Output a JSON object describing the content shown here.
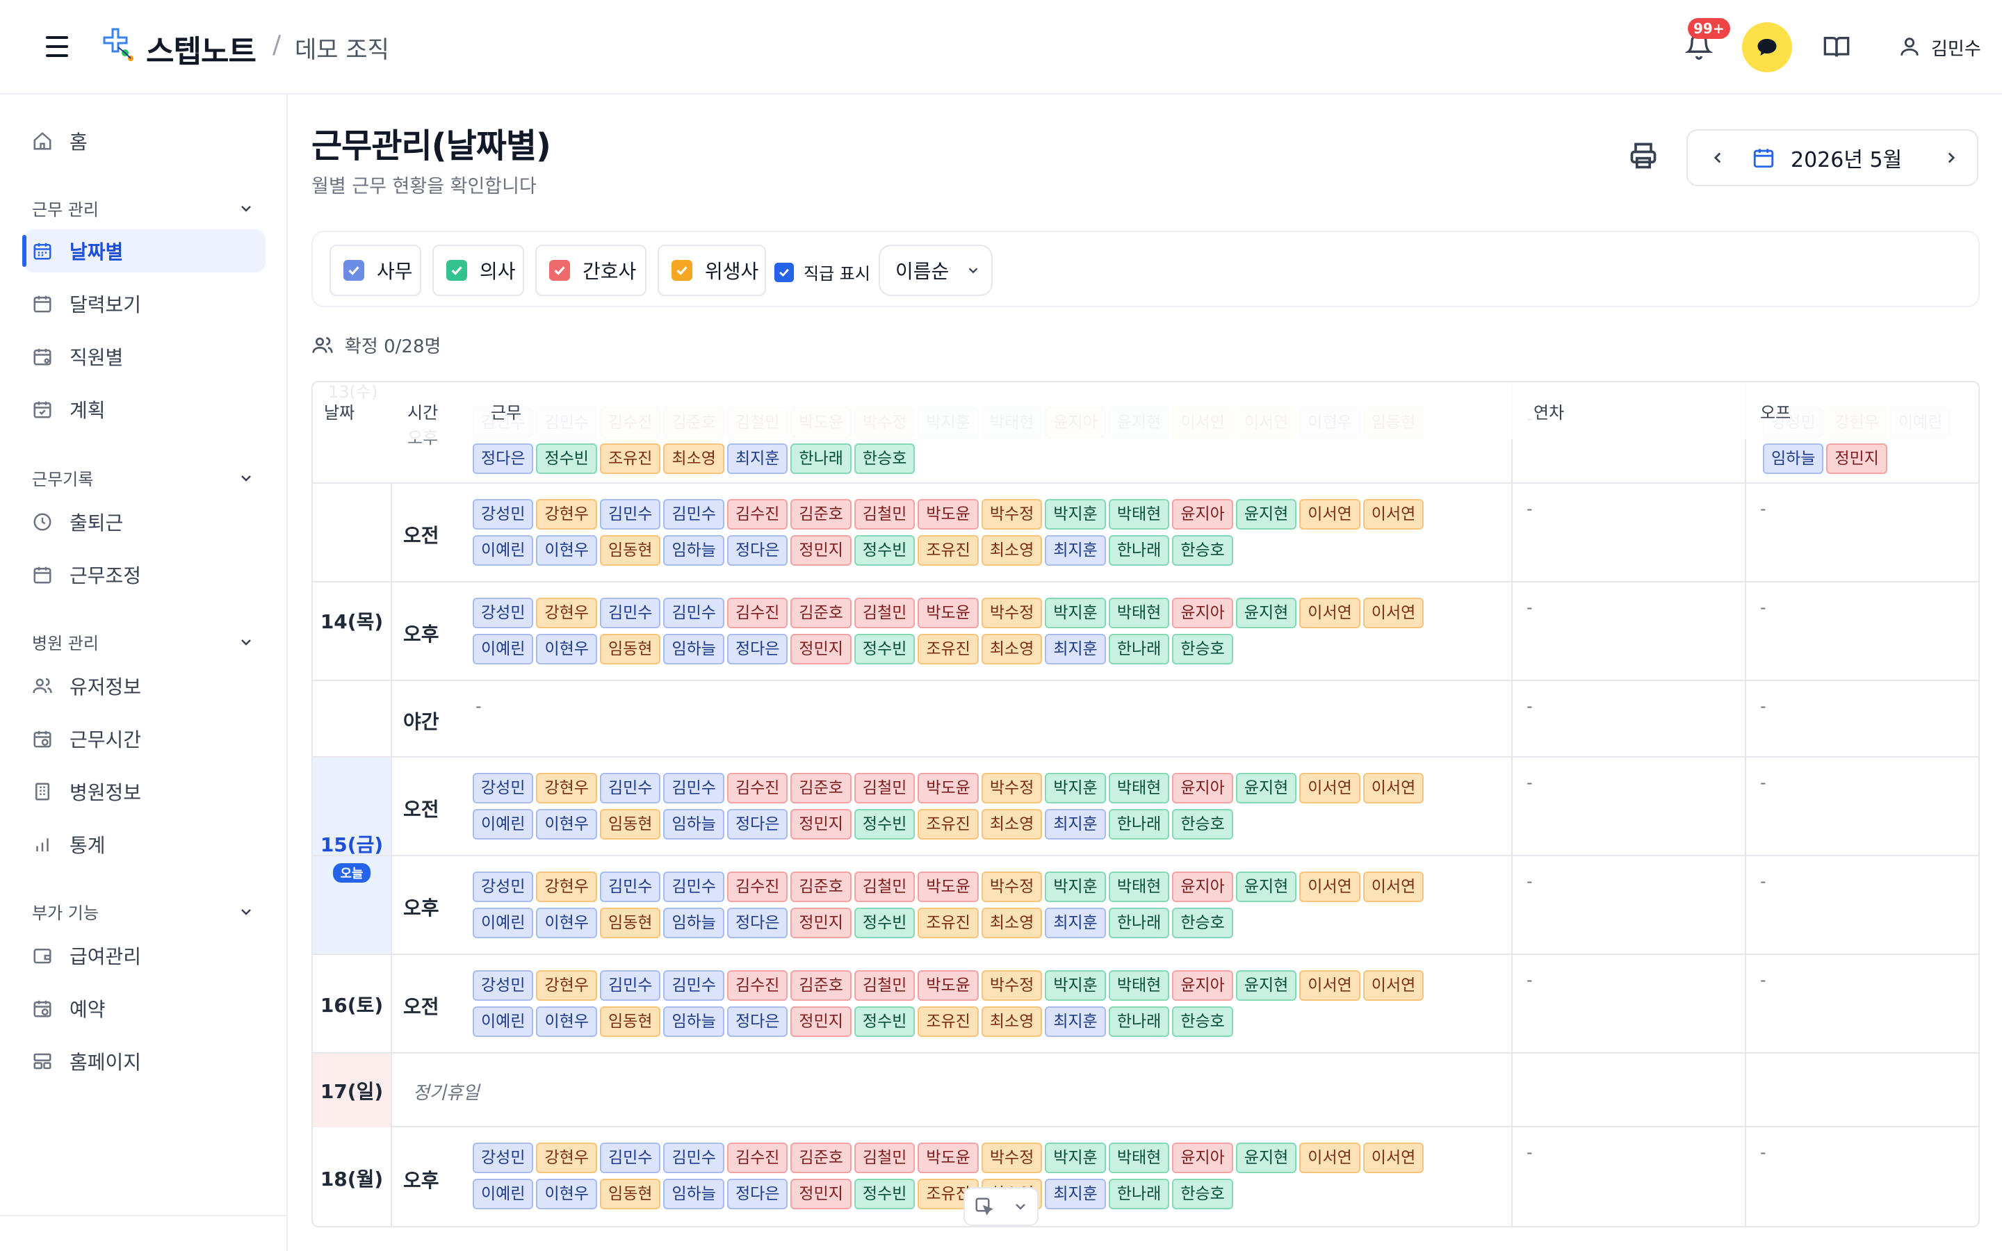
{
  "header": {
    "brand": "스텝노트",
    "org": "데모 조직",
    "notif_badge": "99+",
    "user_name": "김민수"
  },
  "sidebar": {
    "home": "홈",
    "sec_work": "근무 관리",
    "by_date": "날짜별",
    "calendar": "달력보기",
    "by_staff": "직원별",
    "plan": "계획",
    "sec_record": "근무기록",
    "attendance": "출퇴근",
    "adjust": "근무조정",
    "sec_hospital": "병원 관리",
    "user_info": "유저정보",
    "work_time": "근무시간",
    "hospital_info": "병원정보",
    "stats": "통계",
    "sec_extra": "부가 기능",
    "payroll": "급여관리",
    "reservation": "예약",
    "homepage": "홈페이지"
  },
  "page": {
    "title": "근무관리(날짜별)",
    "subtitle": "월별 근무 현황을 확인합니다",
    "month": "2026년 5월"
  },
  "filters": {
    "office": "사무",
    "doctor": "의사",
    "nurse": "간호사",
    "hygienist": "위생사",
    "show_rank": "직급 표시",
    "sort": "이름순"
  },
  "colors": {
    "office": "#6b8de3",
    "doctor": "#34c38f",
    "nurse": "#ef6b6b",
    "hygienist": "#f5a623",
    "accent": "#2563eb"
  },
  "confirm_text": "확정 0/28명",
  "table": {
    "col_date": "날짜",
    "col_time": "시간",
    "col_work": "근무",
    "col_leave": "연차",
    "col_off": "오프",
    "prev_date": "13(수)",
    "prev_time": "오후",
    "prev_row1": [
      "김민수",
      "김민수",
      "김수진",
      "김준호",
      "김철민",
      "박도윤",
      "박수정",
      "박지훈",
      "박태현",
      "윤지아",
      "윤지현",
      "이서연",
      "이서연",
      "이현우",
      "임동현"
    ],
    "prev_row2": [
      "정다은",
      "정수빈",
      "조유진",
      "최소영",
      "최지훈",
      "한나래",
      "한승호"
    ],
    "prev_off": [
      "강성민",
      "강현우",
      "이예린",
      "임하늘",
      "정민지"
    ],
    "full_row1": [
      "강성민",
      "강현우",
      "김민수",
      "김민수",
      "김수진",
      "김준호",
      "김철민",
      "박도윤",
      "박수정",
      "박지훈",
      "박태현",
      "윤지아",
      "윤지현",
      "이서연",
      "이서연"
    ],
    "full_row2": [
      "이예린",
      "이현우",
      "임동현",
      "임하늘",
      "정다은",
      "정민지",
      "정수빈",
      "조유진",
      "최소영",
      "최지훈",
      "한나래",
      "한승호"
    ],
    "d14": "14(목)",
    "d15": "15(금)",
    "today": "오늘",
    "d16": "16(토)",
    "d17": "17(일)",
    "d18": "18(월)",
    "am": "오전",
    "pm": "오후",
    "night": "야간",
    "holiday": "정기휴일",
    "dash": "-"
  }
}
